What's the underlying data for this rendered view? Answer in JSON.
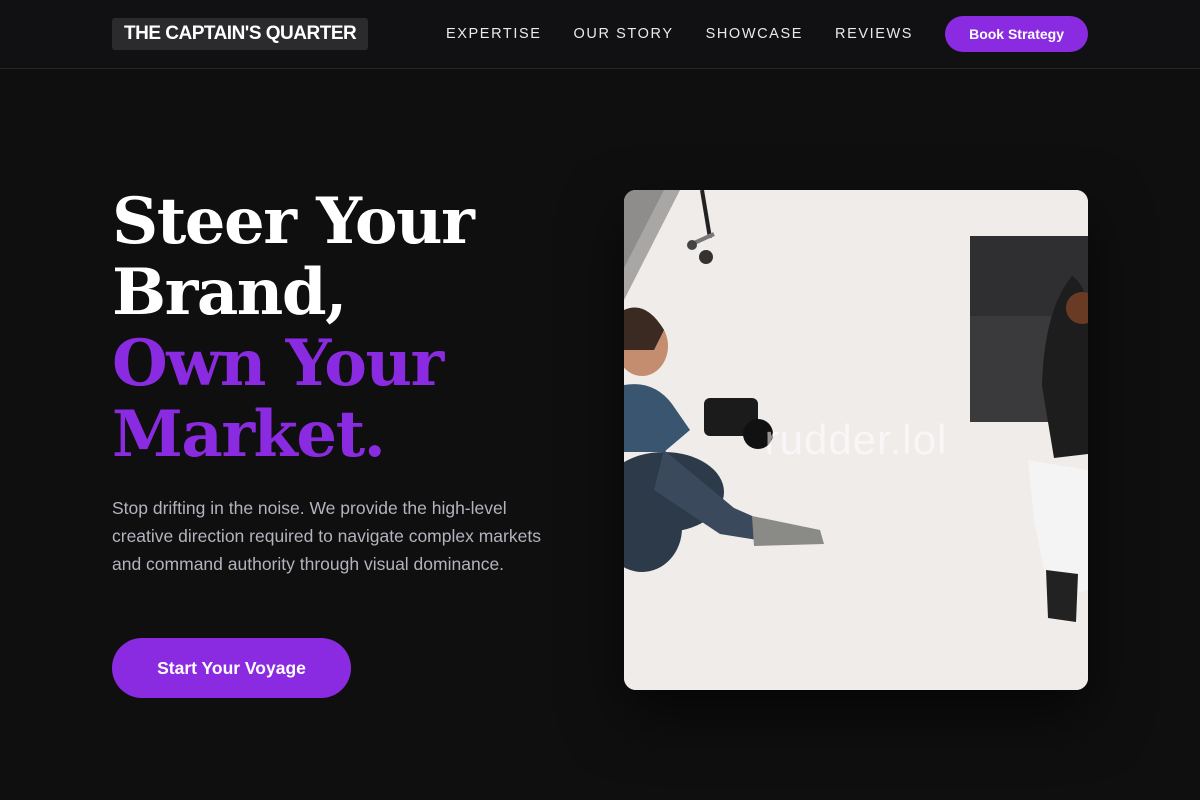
{
  "brand": {
    "name": "THE CAPTAIN'S QUARTER"
  },
  "nav": {
    "items": [
      "EXPERTISE",
      "OUR STORY",
      "SHOWCASE",
      "REVIEWS"
    ],
    "cta_label": "Book Strategy"
  },
  "hero": {
    "title_lines": [
      "Steer Your",
      "Brand,"
    ],
    "title_accent_lines": [
      "Own Your",
      "Market."
    ],
    "subtitle": "Stop drifting in the noise. We provide the high-level creative direction required to navigate complex markets and command authority through visual dominance.",
    "cta_label": "Start Your Voyage",
    "media": {
      "watermark": "rudder.lol"
    }
  },
  "colors": {
    "accent": "#8a2be2",
    "background": "#0f0f10",
    "subtext": "#b3b3bd"
  }
}
